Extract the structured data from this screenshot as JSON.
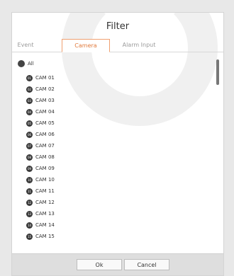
{
  "dialog": {
    "title": "Filter"
  },
  "tabs": [
    {
      "label": "Event"
    },
    {
      "label": "Camera"
    },
    {
      "label": "Alarm Input"
    }
  ],
  "list": {
    "all_label": "All",
    "items": [
      {
        "num": "01",
        "label": "CAM 01"
      },
      {
        "num": "02",
        "label": "CAM 02"
      },
      {
        "num": "03",
        "label": "CAM 03"
      },
      {
        "num": "04",
        "label": "CAM 04"
      },
      {
        "num": "05",
        "label": "CAM 05"
      },
      {
        "num": "06",
        "label": "CAM 06"
      },
      {
        "num": "07",
        "label": "CAM 07"
      },
      {
        "num": "08",
        "label": "CAM 08"
      },
      {
        "num": "09",
        "label": "CAM 09"
      },
      {
        "num": "10",
        "label": "CAM 10"
      },
      {
        "num": "11",
        "label": "CAM 11"
      },
      {
        "num": "12",
        "label": "CAM 12"
      },
      {
        "num": "13",
        "label": "CAM 13"
      },
      {
        "num": "14",
        "label": "CAM 14"
      },
      {
        "num": "15",
        "label": "CAM 15"
      }
    ]
  },
  "buttons": {
    "ok": "Ok",
    "cancel": "Cancel"
  },
  "colors": {
    "active_tab": "#e07a3c",
    "check_circle": "#3a3a3a"
  }
}
